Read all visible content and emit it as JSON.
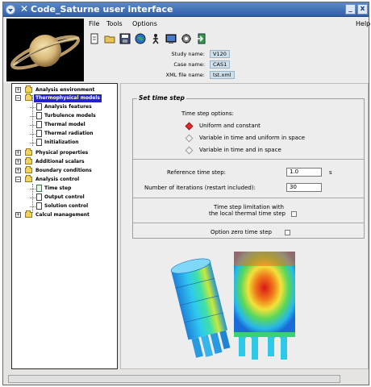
{
  "window": {
    "title": "Code_Saturne user interface",
    "close_glyph": "✕",
    "minimize_glyph": "_",
    "maximize_glyph": "x"
  },
  "menu": {
    "file": "File",
    "tools": "Tools",
    "options": "Options",
    "help": "Help"
  },
  "toolbar": {
    "icons": [
      "new-file-icon",
      "open-folder-icon",
      "save-icon",
      "globe-icon",
      "run-icon",
      "terminal-icon",
      "process-icon",
      "exit-icon"
    ]
  },
  "study_info": {
    "study_name_label": "Study name:",
    "study_name_value": "V120",
    "case_name_label": "Case name:",
    "case_name_value": "CAS1",
    "xml_file_label": "XML file name:",
    "xml_file_value": "tst.xml"
  },
  "tree": {
    "analysis_environment": "Analysis environment",
    "thermophysical_models": "Thermophysical models",
    "analysis_features": "Analysis features",
    "turbulence_models": "Turbulence models",
    "thermal_model": "Thermal model",
    "thermal_radiation": "Thermal radiation",
    "initialization": "Initialization",
    "physical_properties": "Physical properties",
    "additional_scalars": "Additional scalars",
    "boundary_conditions": "Boundary conditions",
    "analysis_control": "Analysis control",
    "time_step": "Time step",
    "output_control": "Output control",
    "solution_control": "Solution control",
    "calcul_management": "Calcul management",
    "expand_glyph": "+",
    "collapse_glyph": "−"
  },
  "time_step_panel": {
    "group_title": "Set time step",
    "options_label": "Time step options:",
    "option_uniform": "Uniform and constant",
    "option_variable_uniform": "Variable in time and uniform in space",
    "option_variable": "Variable in time and in space",
    "selected_option": "uniform",
    "reference_label": "Reference time step:",
    "reference_value": "1.0",
    "reference_unit": "s",
    "iterations_label": "Number of iterations (restart included):",
    "iterations_value": "30",
    "limitation_line1": "Time step limitation with",
    "limitation_line2": "the local thermal time step",
    "zero_time_step_label": "Option zero time step"
  },
  "colors": {
    "title_bar": "#2f5fa8",
    "selection": "#2222c8",
    "radio_selected": "#e52b2b",
    "field_info_bg": "#cfe0ea"
  }
}
